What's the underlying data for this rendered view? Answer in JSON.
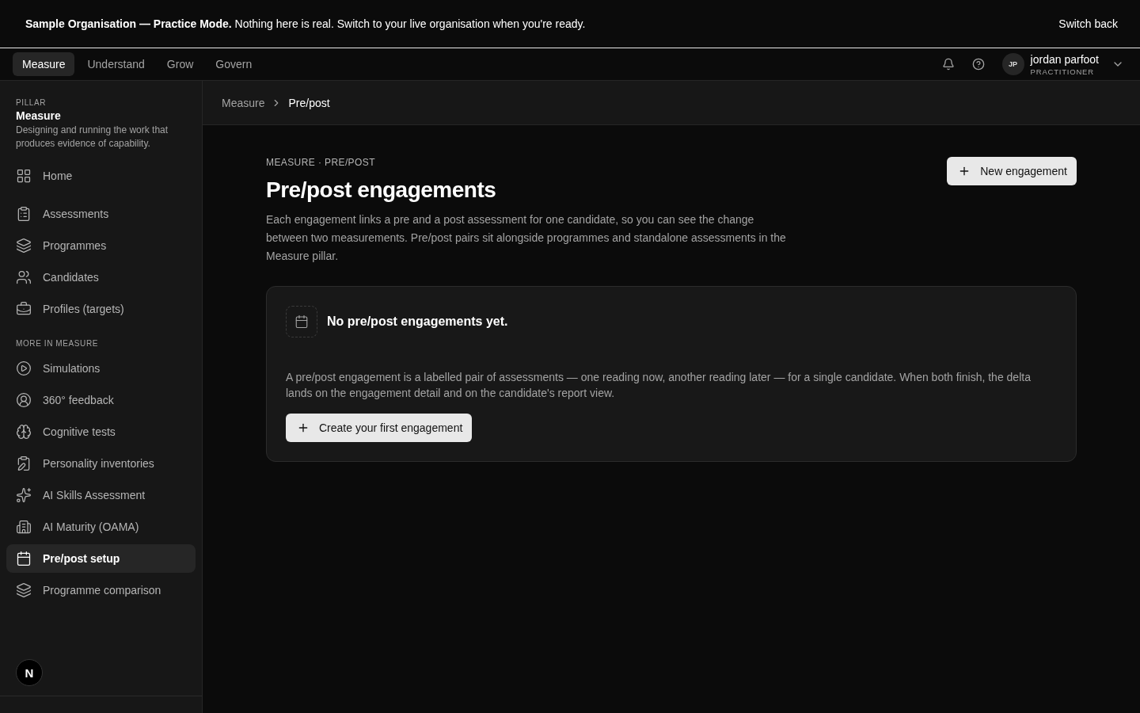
{
  "banner": {
    "message": "**Sample Organisation — Practice Mode.** Nothing here is real. Switch to your live organisation when you're ready.",
    "action": "Switch back"
  },
  "tabs": [
    {
      "label": "Measure",
      "selected": true
    },
    {
      "label": "Understand",
      "selected": false
    },
    {
      "label": "Grow",
      "selected": false
    },
    {
      "label": "Govern",
      "selected": false
    }
  ],
  "user": {
    "initials": "JP",
    "name": "jordan parfoot",
    "role": "PRACTITIONER"
  },
  "sidebar": {
    "eyebrow": "PILLAR",
    "title": "Measure",
    "description": "Designing and running the work that produces evidence of capability.",
    "home": {
      "label": "Home",
      "selected": false
    },
    "items": [
      {
        "label": "Assessments",
        "selected": false
      },
      {
        "label": "Programmes",
        "selected": false
      },
      {
        "label": "Candidates",
        "selected": false
      },
      {
        "label": "Profiles (targets)",
        "selected": false
      }
    ],
    "more_heading": "MORE IN MEASURE",
    "more_items": [
      {
        "label": "Simulations",
        "selected": false
      },
      {
        "label": "360° feedback",
        "selected": false
      },
      {
        "label": "Cognitive tests",
        "selected": false
      },
      {
        "label": "Personality inventories",
        "selected": false
      },
      {
        "label": "AI Skills Assessment",
        "selected": false
      },
      {
        "label": "AI Maturity (OAMA)",
        "selected": false
      },
      {
        "label": "Pre/post setup",
        "selected": true
      },
      {
        "label": "Programme comparison",
        "selected": false
      }
    ],
    "badge": "N"
  },
  "breadcrumb": [
    "Measure",
    "Pre/post"
  ],
  "page": {
    "eyebrow": "MEASURE · PRE/POST",
    "title": "Pre/post engagements",
    "description": "Each engagement links a pre and a post assessment for one candidate, so you can see the change between two measurements. Pre/post pairs sit alongside programmes and standalone assessments in the Measure pillar.",
    "new_button": "New engagement"
  },
  "empty_state": {
    "title": "No pre/post engagements yet.",
    "text": "A pre/post engagement is a labelled pair of assessments — one reading now, another reading later — for a single candidate. When both finish, the delta lands on the engagement detail and on the candidate's report view.",
    "button": "Create your first engagement"
  }
}
